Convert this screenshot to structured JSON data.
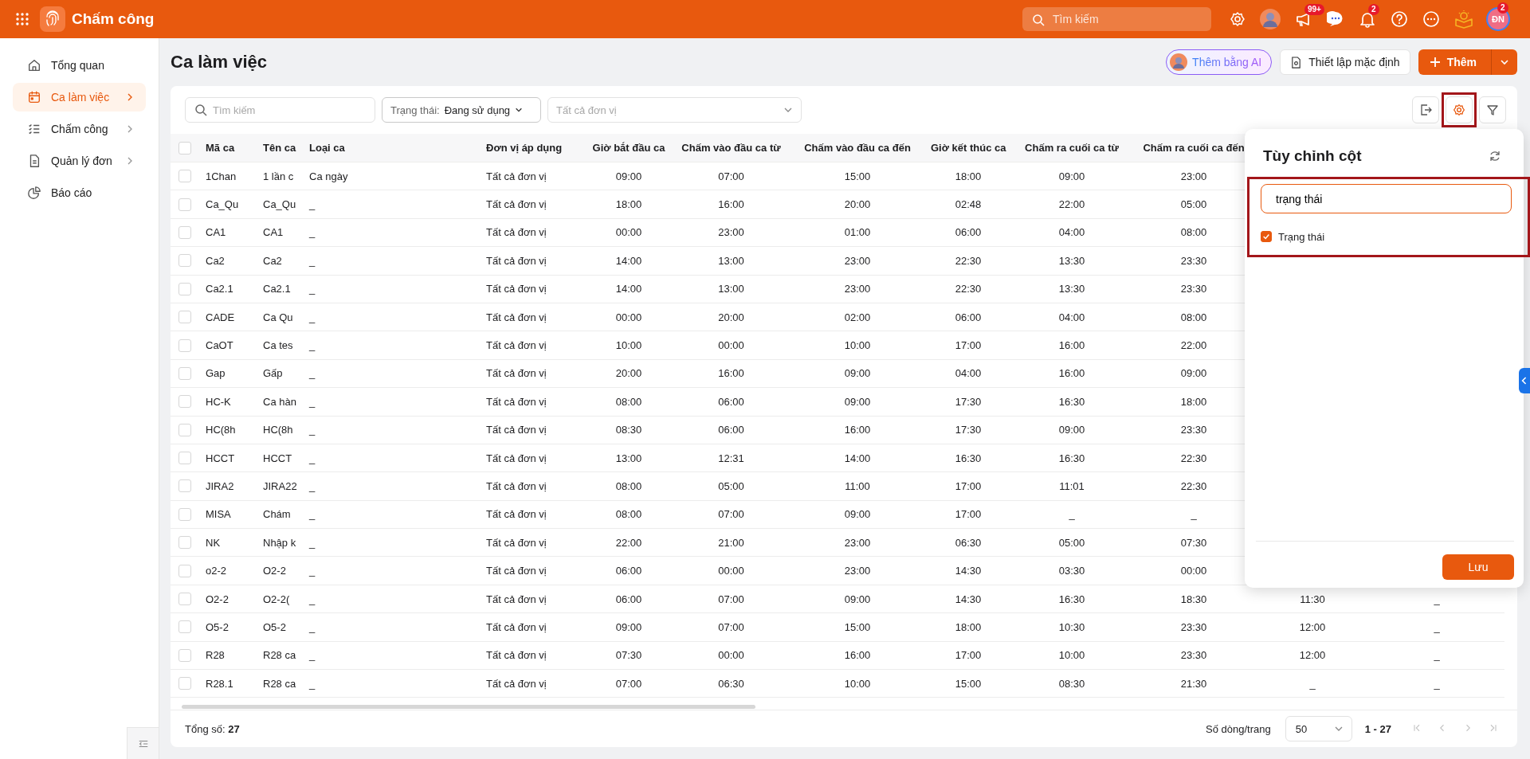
{
  "app": {
    "title": "Chấm công"
  },
  "topbar": {
    "search": {
      "placeholder": "Tìm kiếm"
    },
    "icons": [
      {
        "kind": "settings"
      },
      {
        "kind": "avatar"
      },
      {
        "kind": "megaphone",
        "badge": "99+"
      },
      {
        "kind": "chat"
      },
      {
        "kind": "bell",
        "badge": "2"
      },
      {
        "kind": "help"
      },
      {
        "kind": "more"
      },
      {
        "kind": "idea"
      }
    ],
    "user": {
      "initials": "ĐN",
      "badge": "2"
    }
  },
  "sidebar": {
    "items": [
      {
        "kind": "home",
        "label": "Tổng quan",
        "selected": false,
        "expandable": false
      },
      {
        "kind": "calendar",
        "label": "Ca làm việc",
        "selected": true,
        "expandable": true
      },
      {
        "kind": "checklist",
        "label": "Chấm công",
        "selected": false,
        "expandable": true
      },
      {
        "kind": "document",
        "label": "Quản lý đơn",
        "selected": false,
        "expandable": true
      },
      {
        "kind": "chart",
        "label": "Báo cáo",
        "selected": false,
        "expandable": false
      }
    ]
  },
  "page": {
    "title": "Ca làm việc",
    "actions": [
      {
        "kind": "ai",
        "label": "Thêm bằng AI"
      },
      {
        "kind": "default",
        "label": "Thiết lập mặc định"
      },
      {
        "kind": "add",
        "label": "Thêm"
      }
    ]
  },
  "toolbar": {
    "search": {
      "placeholder": "Tìm kiếm"
    },
    "status_filter": {
      "label": "Trạng thái:",
      "value": "Đang sử dụng"
    },
    "unit_filter": {
      "placeholder": "Tất cả đơn vị"
    },
    "column_settings": {
      "selected": true,
      "highlighted": true
    }
  },
  "table": {
    "header_checked": false,
    "columns": [
      "Mã ca",
      "Tên ca",
      "Loại ca",
      "Đơn vị áp dụng",
      "Giờ bắt đầu ca",
      "Chấm vào đầu ca từ",
      "Chấm vào đầu ca đến",
      "Giờ kết thúc ca",
      "Chấm ra cuối ca từ",
      "Chấm ra cuối ca đến"
    ],
    "rows": [
      {
        "selected": false,
        "cells": [
          "1Chan",
          "1 lần c",
          "Ca ngày",
          "Tất cả đơn vị",
          "09:00",
          "07:00",
          "15:00",
          "18:00",
          "09:00",
          "23:00"
        ]
      },
      {
        "selected": false,
        "cells": [
          "Ca_Qu",
          "Ca_Qu",
          "_",
          "Tất cả đơn vị",
          "18:00",
          "16:00",
          "20:00",
          "02:48",
          "22:00",
          "05:00"
        ]
      },
      {
        "selected": false,
        "cells": [
          "CA1",
          "CA1",
          "_",
          "Tất cả đơn vị",
          "00:00",
          "23:00",
          "01:00",
          "06:00",
          "04:00",
          "08:00"
        ]
      },
      {
        "selected": false,
        "cells": [
          "Ca2",
          "Ca2",
          "_",
          "Tất cả đơn vị",
          "14:00",
          "13:00",
          "23:00",
          "22:30",
          "13:30",
          "23:30"
        ]
      },
      {
        "selected": false,
        "cells": [
          "Ca2.1",
          "Ca2.1",
          "_",
          "Tất cả đơn vị",
          "14:00",
          "13:00",
          "23:00",
          "22:30",
          "13:30",
          "23:30"
        ]
      },
      {
        "selected": false,
        "cells": [
          "CADE",
          "Ca Qu",
          "_",
          "Tất cả đơn vị",
          "00:00",
          "20:00",
          "02:00",
          "06:00",
          "04:00",
          "08:00"
        ]
      },
      {
        "selected": false,
        "cells": [
          "CaOT",
          "Ca tes",
          "_",
          "Tất cả đơn vị",
          "10:00",
          "00:00",
          "10:00",
          "17:00",
          "16:00",
          "22:00"
        ]
      },
      {
        "selected": false,
        "cells": [
          "Gap",
          "Gấp",
          "_",
          "Tất cả đơn vị",
          "20:00",
          "16:00",
          "09:00",
          "04:00",
          "16:00",
          "09:00"
        ]
      },
      {
        "selected": false,
        "cells": [
          "HC-K",
          "Ca hàn",
          "_",
          "Tất cả đơn vị",
          "08:00",
          "06:00",
          "09:00",
          "17:30",
          "16:30",
          "18:00"
        ]
      },
      {
        "selected": false,
        "cells": [
          "HC(8h",
          "HC(8h",
          "_",
          "Tất cả đơn vị",
          "08:30",
          "06:00",
          "16:00",
          "17:30",
          "09:00",
          "23:30"
        ]
      },
      {
        "selected": false,
        "cells": [
          "HCCT",
          "HCCT",
          "_",
          "Tất cả đơn vị",
          "13:00",
          "12:31",
          "14:00",
          "16:30",
          "16:30",
          "22:30"
        ]
      },
      {
        "selected": false,
        "cells": [
          "JIRA2",
          "JIRA22",
          "_",
          "Tất cả đơn vị",
          "08:00",
          "05:00",
          "11:00",
          "17:00",
          "11:01",
          "22:30"
        ]
      },
      {
        "selected": false,
        "cells": [
          "MISA",
          "Chám",
          "_",
          "Tất cả đơn vị",
          "08:00",
          "07:00",
          "09:00",
          "17:00",
          "_",
          "_"
        ]
      },
      {
        "selected": false,
        "cells": [
          "NK",
          "Nhập k",
          "_",
          "Tất cả đơn vị",
          "22:00",
          "21:00",
          "23:00",
          "06:30",
          "05:00",
          "07:30"
        ]
      },
      {
        "selected": false,
        "cells": [
          "o2-2",
          "O2-2",
          "_",
          "Tất cả đơn vị",
          "06:00",
          "00:00",
          "23:00",
          "14:30",
          "03:30",
          "00:00"
        ]
      },
      {
        "selected": false,
        "cells": [
          "O2-2",
          "O2-2(",
          "_",
          "Tất cả đơn vị",
          "06:00",
          "07:00",
          "09:00",
          "14:30",
          "16:30",
          "18:30",
          "11:30",
          "_"
        ]
      },
      {
        "selected": false,
        "cells": [
          "O5-2",
          "O5-2",
          "_",
          "Tất cả đơn vị",
          "09:00",
          "07:00",
          "15:00",
          "18:00",
          "10:30",
          "23:30",
          "12:00",
          "_"
        ]
      },
      {
        "selected": false,
        "cells": [
          "R28",
          "R28 ca",
          "_",
          "Tất cả đơn vị",
          "07:30",
          "00:00",
          "16:00",
          "17:00",
          "10:00",
          "23:30",
          "12:00",
          "_"
        ]
      },
      {
        "selected": false,
        "cells": [
          "R28.1",
          "R28 ca",
          "_",
          "Tất cả đơn vị",
          "07:00",
          "06:30",
          "10:00",
          "15:00",
          "08:30",
          "21:30",
          "_",
          "_"
        ]
      }
    ]
  },
  "footer": {
    "total_label": "Tổng số:",
    "total": "27",
    "rows_per_page_label": "Số dòng/trang",
    "page_size": "50",
    "range": "1 - 27",
    "pager": [
      {
        "kind": "first",
        "disabled": true
      },
      {
        "kind": "prev",
        "disabled": true
      },
      {
        "kind": "next",
        "disabled": true
      },
      {
        "kind": "last",
        "disabled": true
      }
    ]
  },
  "column_panel": {
    "title": "Tùy chỉnh cột",
    "search": {
      "value": "trạng thái"
    },
    "highlighted": true,
    "items": [
      {
        "label": "Trạng thái",
        "checked": true
      }
    ],
    "save_label": "Lưu"
  }
}
